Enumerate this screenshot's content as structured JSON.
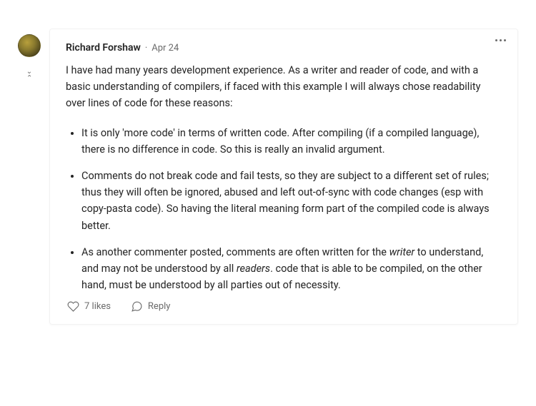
{
  "comment": {
    "author": "Richard Forshaw",
    "date": "Apr 24",
    "intro": "I have had many years development experience. As a writer and reader of code, and with a basic understanding of compilers, if faced with this example I will always chose readability over lines of code for these reasons:",
    "bullets": [
      "It is only 'more code' in terms of written code. After compiling (if a compiled language), there is no difference in code. So this is really an invalid argument.",
      "Comments do not break code and fail tests, so they are subject to a different set of rules; thus they will often be ignored, abused and left out-of-sync with code changes (esp with copy-pasta code). So having the literal meaning form part of the compiled code is always better."
    ],
    "bullet3_html": "As another commenter posted, comments are often written for the <em>writer</em> to understand, and may not be understood by all <em>readers</em>. code that is able to be compiled, on the other hand, must be understood by all parties out of necessity.",
    "likes_label": "7 likes",
    "reply_label": "Reply"
  }
}
